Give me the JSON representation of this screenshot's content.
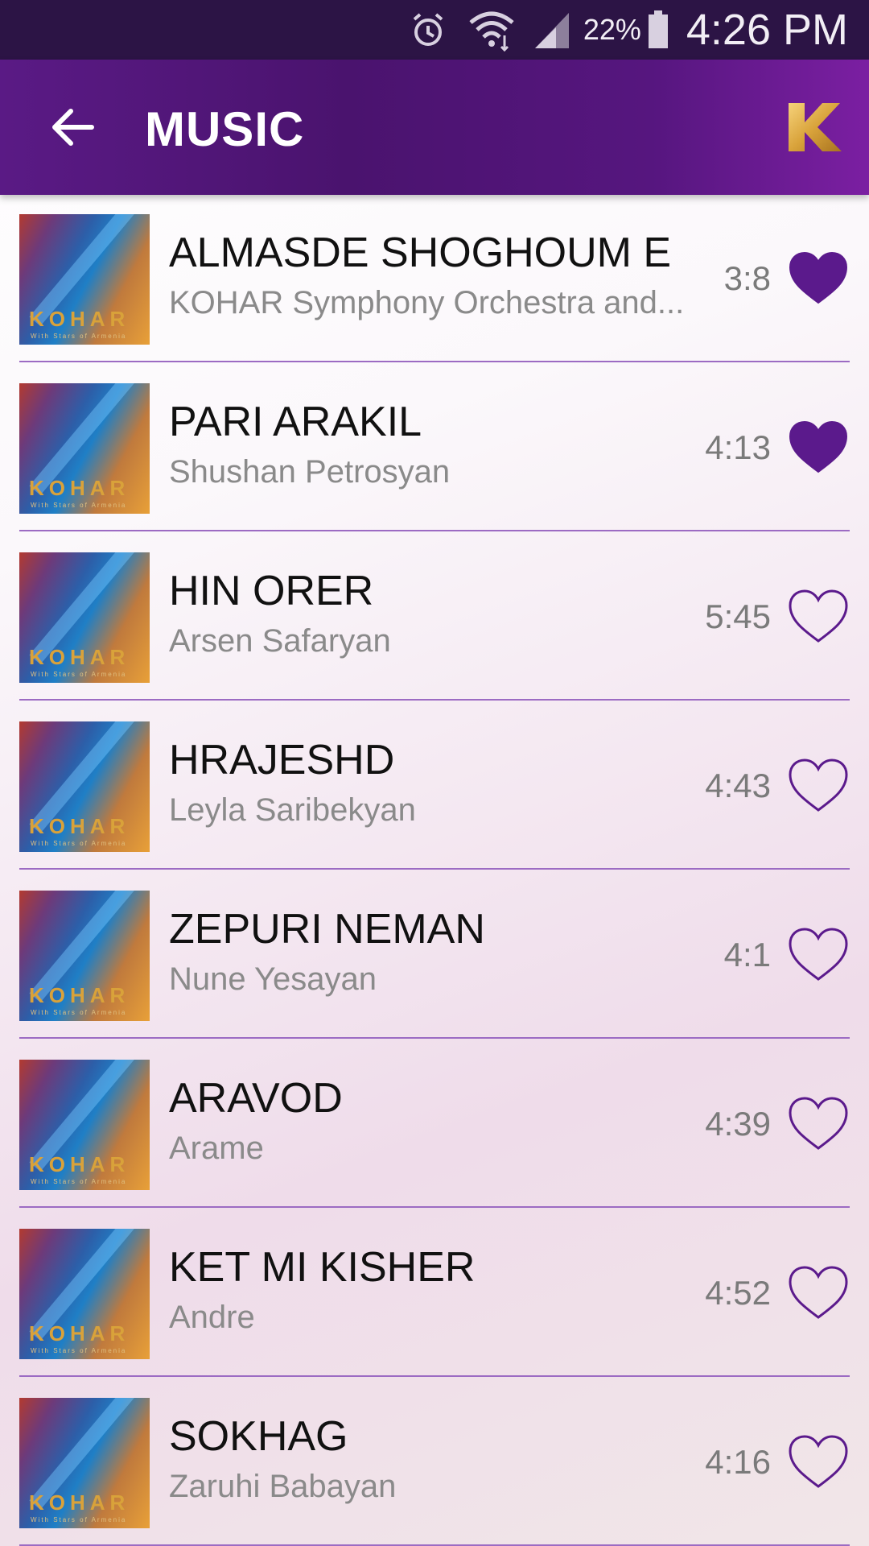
{
  "status_bar": {
    "battery_percent": "22%",
    "time": "4:26 PM"
  },
  "app_bar": {
    "title": "MUSIC",
    "logo_letter": "K"
  },
  "album_art": {
    "brand": "KOHAR",
    "subtitle": "With Stars of Armenia"
  },
  "colors": {
    "accent": "#5b1a8c",
    "divider": "#9c6bc3"
  },
  "tracks": [
    {
      "title": "ALMASDE SHOGHOUM E",
      "artist": "KOHAR Symphony Orchestra and...",
      "duration": "3:8",
      "favorite": true
    },
    {
      "title": "PARI ARAKIL",
      "artist": "Shushan Petrosyan",
      "duration": "4:13",
      "favorite": true
    },
    {
      "title": "HIN ORER",
      "artist": "Arsen Safaryan",
      "duration": "5:45",
      "favorite": false
    },
    {
      "title": "HRAJESHD",
      "artist": "Leyla Saribekyan",
      "duration": "4:43",
      "favorite": false
    },
    {
      "title": "ZEPURI NEMAN",
      "artist": "Nune Yesayan",
      "duration": "4:1",
      "favorite": false
    },
    {
      "title": "ARAVOD",
      "artist": "Arame",
      "duration": "4:39",
      "favorite": false
    },
    {
      "title": "KET MI KISHER",
      "artist": "Andre",
      "duration": "4:52",
      "favorite": false
    },
    {
      "title": "SOKHAG",
      "artist": "Zaruhi Babayan",
      "duration": "4:16",
      "favorite": false
    }
  ]
}
